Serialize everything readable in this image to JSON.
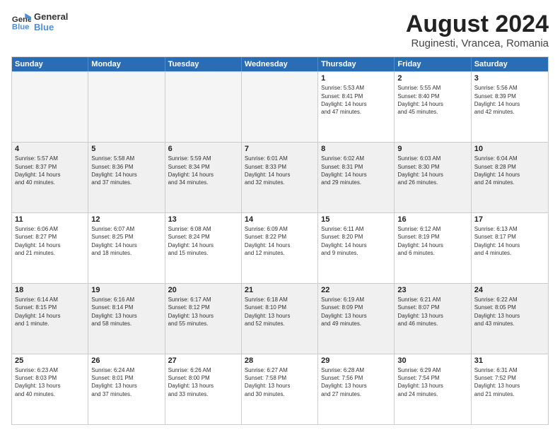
{
  "logo": {
    "line1": "General",
    "line2": "Blue"
  },
  "title": "August 2024",
  "location": "Ruginesti, Vrancea, Romania",
  "days": [
    "Sunday",
    "Monday",
    "Tuesday",
    "Wednesday",
    "Thursday",
    "Friday",
    "Saturday"
  ],
  "weeks": [
    [
      {
        "day": "",
        "info": ""
      },
      {
        "day": "",
        "info": ""
      },
      {
        "day": "",
        "info": ""
      },
      {
        "day": "",
        "info": ""
      },
      {
        "day": "1",
        "info": "Sunrise: 5:53 AM\nSunset: 8:41 PM\nDaylight: 14 hours\nand 47 minutes."
      },
      {
        "day": "2",
        "info": "Sunrise: 5:55 AM\nSunset: 8:40 PM\nDaylight: 14 hours\nand 45 minutes."
      },
      {
        "day": "3",
        "info": "Sunrise: 5:56 AM\nSunset: 8:39 PM\nDaylight: 14 hours\nand 42 minutes."
      }
    ],
    [
      {
        "day": "4",
        "info": "Sunrise: 5:57 AM\nSunset: 8:37 PM\nDaylight: 14 hours\nand 40 minutes."
      },
      {
        "day": "5",
        "info": "Sunrise: 5:58 AM\nSunset: 8:36 PM\nDaylight: 14 hours\nand 37 minutes."
      },
      {
        "day": "6",
        "info": "Sunrise: 5:59 AM\nSunset: 8:34 PM\nDaylight: 14 hours\nand 34 minutes."
      },
      {
        "day": "7",
        "info": "Sunrise: 6:01 AM\nSunset: 8:33 PM\nDaylight: 14 hours\nand 32 minutes."
      },
      {
        "day": "8",
        "info": "Sunrise: 6:02 AM\nSunset: 8:31 PM\nDaylight: 14 hours\nand 29 minutes."
      },
      {
        "day": "9",
        "info": "Sunrise: 6:03 AM\nSunset: 8:30 PM\nDaylight: 14 hours\nand 26 minutes."
      },
      {
        "day": "10",
        "info": "Sunrise: 6:04 AM\nSunset: 8:28 PM\nDaylight: 14 hours\nand 24 minutes."
      }
    ],
    [
      {
        "day": "11",
        "info": "Sunrise: 6:06 AM\nSunset: 8:27 PM\nDaylight: 14 hours\nand 21 minutes."
      },
      {
        "day": "12",
        "info": "Sunrise: 6:07 AM\nSunset: 8:25 PM\nDaylight: 14 hours\nand 18 minutes."
      },
      {
        "day": "13",
        "info": "Sunrise: 6:08 AM\nSunset: 8:24 PM\nDaylight: 14 hours\nand 15 minutes."
      },
      {
        "day": "14",
        "info": "Sunrise: 6:09 AM\nSunset: 8:22 PM\nDaylight: 14 hours\nand 12 minutes."
      },
      {
        "day": "15",
        "info": "Sunrise: 6:11 AM\nSunset: 8:20 PM\nDaylight: 14 hours\nand 9 minutes."
      },
      {
        "day": "16",
        "info": "Sunrise: 6:12 AM\nSunset: 8:19 PM\nDaylight: 14 hours\nand 6 minutes."
      },
      {
        "day": "17",
        "info": "Sunrise: 6:13 AM\nSunset: 8:17 PM\nDaylight: 14 hours\nand 4 minutes."
      }
    ],
    [
      {
        "day": "18",
        "info": "Sunrise: 6:14 AM\nSunset: 8:15 PM\nDaylight: 14 hours\nand 1 minute."
      },
      {
        "day": "19",
        "info": "Sunrise: 6:16 AM\nSunset: 8:14 PM\nDaylight: 13 hours\nand 58 minutes."
      },
      {
        "day": "20",
        "info": "Sunrise: 6:17 AM\nSunset: 8:12 PM\nDaylight: 13 hours\nand 55 minutes."
      },
      {
        "day": "21",
        "info": "Sunrise: 6:18 AM\nSunset: 8:10 PM\nDaylight: 13 hours\nand 52 minutes."
      },
      {
        "day": "22",
        "info": "Sunrise: 6:19 AM\nSunset: 8:09 PM\nDaylight: 13 hours\nand 49 minutes."
      },
      {
        "day": "23",
        "info": "Sunrise: 6:21 AM\nSunset: 8:07 PM\nDaylight: 13 hours\nand 46 minutes."
      },
      {
        "day": "24",
        "info": "Sunrise: 6:22 AM\nSunset: 8:05 PM\nDaylight: 13 hours\nand 43 minutes."
      }
    ],
    [
      {
        "day": "25",
        "info": "Sunrise: 6:23 AM\nSunset: 8:03 PM\nDaylight: 13 hours\nand 40 minutes."
      },
      {
        "day": "26",
        "info": "Sunrise: 6:24 AM\nSunset: 8:01 PM\nDaylight: 13 hours\nand 37 minutes."
      },
      {
        "day": "27",
        "info": "Sunrise: 6:26 AM\nSunset: 8:00 PM\nDaylight: 13 hours\nand 33 minutes."
      },
      {
        "day": "28",
        "info": "Sunrise: 6:27 AM\nSunset: 7:58 PM\nDaylight: 13 hours\nand 30 minutes."
      },
      {
        "day": "29",
        "info": "Sunrise: 6:28 AM\nSunset: 7:56 PM\nDaylight: 13 hours\nand 27 minutes."
      },
      {
        "day": "30",
        "info": "Sunrise: 6:29 AM\nSunset: 7:54 PM\nDaylight: 13 hours\nand 24 minutes."
      },
      {
        "day": "31",
        "info": "Sunrise: 6:31 AM\nSunset: 7:52 PM\nDaylight: 13 hours\nand 21 minutes."
      }
    ]
  ]
}
